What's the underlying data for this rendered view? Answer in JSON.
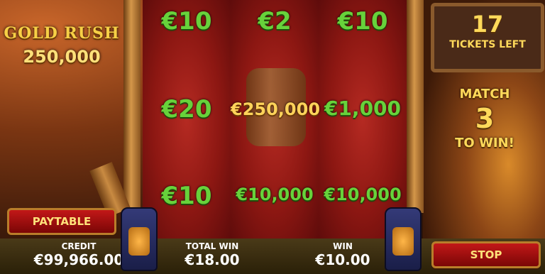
{
  "logo": {
    "title": "GOLD RUSH",
    "amount": "250,000"
  },
  "grid": {
    "cells": [
      {
        "text": "€10",
        "style": "gold-no"
      },
      {
        "text": "€2"
      },
      {
        "text": "€10"
      },
      {
        "text": "€20"
      },
      {
        "text": "€250,000",
        "gold": true
      },
      {
        "text": "€1,000"
      },
      {
        "text": "€10"
      },
      {
        "text": "€10,000"
      },
      {
        "text": "€10,000"
      }
    ]
  },
  "tickets": {
    "count": "17",
    "label": "TICKETS LEFT"
  },
  "match": {
    "line1": "MATCH",
    "line2": "3",
    "line3": "TO WIN!"
  },
  "buttons": {
    "paytable": "PAYTABLE",
    "stop": "STOP"
  },
  "stats": {
    "credit": {
      "label": "CREDIT",
      "value": "€99,966.00"
    },
    "total_win": {
      "label": "TOTAL WIN",
      "value": "€18.00"
    },
    "win": {
      "label": "WIN",
      "value": "€10.00"
    }
  },
  "icons": {
    "dynamite": "dynamite-icon",
    "lantern": "lantern-icon"
  }
}
